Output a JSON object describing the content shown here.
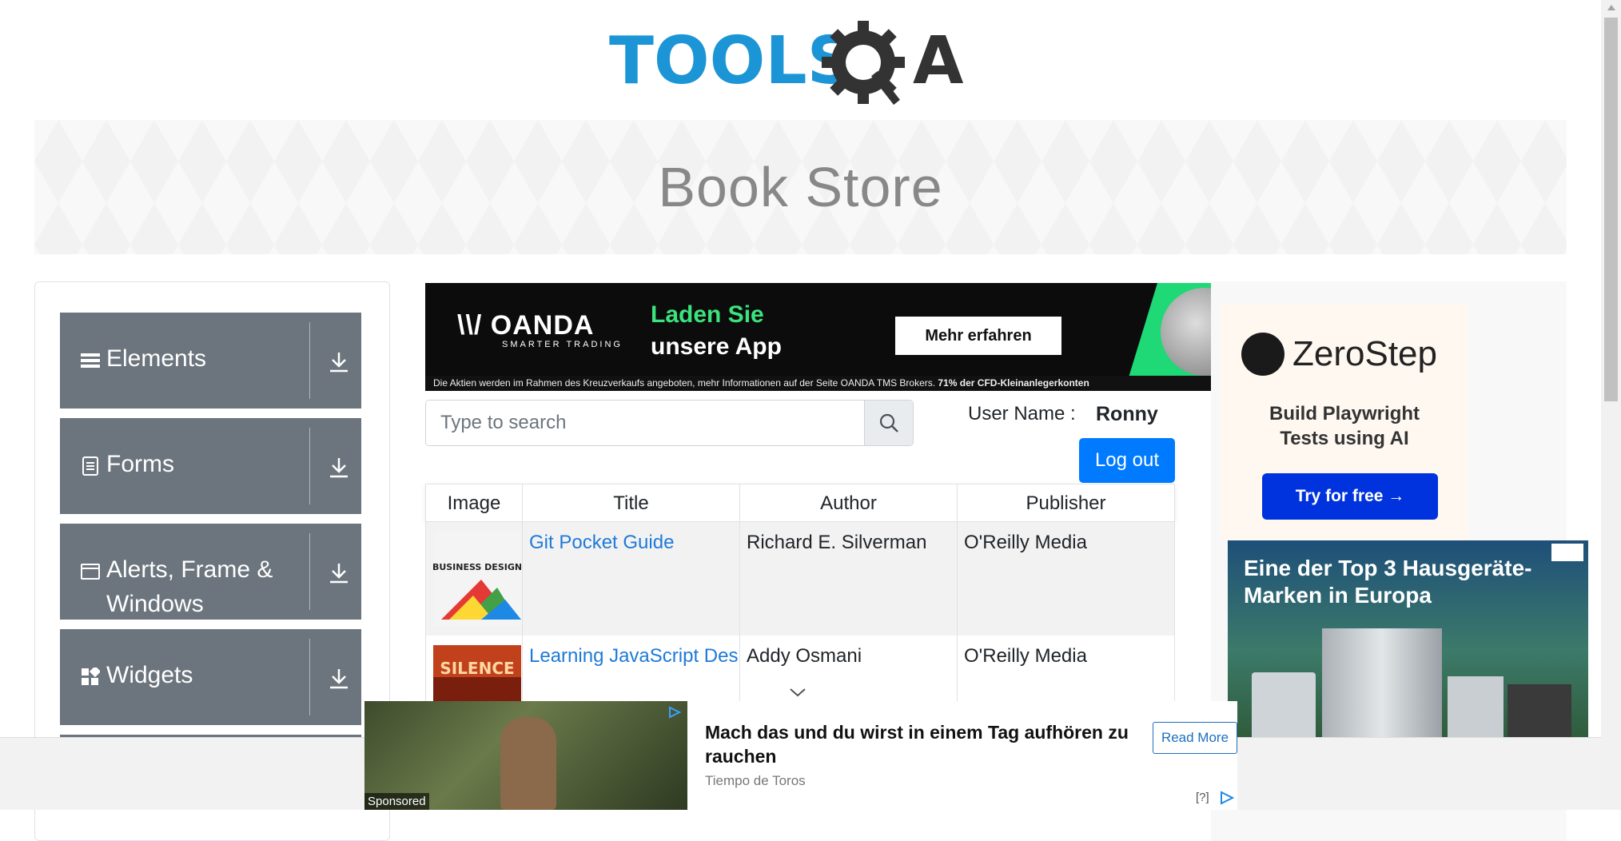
{
  "logo": {
    "text_left": "TOOLS",
    "text_right": "A",
    "colors": {
      "tools": "#1b95d5",
      "gear": "#333333"
    }
  },
  "banner": {
    "title": "Book Store"
  },
  "sidebar": {
    "groups": [
      {
        "label": "Elements",
        "icon": "hamburger-icon"
      },
      {
        "label": "Forms",
        "icon": "document-icon"
      },
      {
        "label": "Alerts, Frame & Windows",
        "icon": "window-icon"
      },
      {
        "label": "Widgets",
        "icon": "widgets-icon"
      }
    ]
  },
  "top_ad": {
    "brand": "OANDA",
    "brand_sub": "SMARTER TRADING",
    "headline_1": "Laden Sie",
    "headline_2": "unsere App",
    "cta": "Mehr erfahren",
    "disclaimer_1": "Die Aktien werden im Rahmen des Kreuzverkaufs angeboten, mehr Informationen auf der Seite OANDA TMS Brokers. ",
    "disclaimer_2": "71% der CFD-Kleinanlegerkonten"
  },
  "search": {
    "placeholder": "Type to search"
  },
  "user": {
    "label": "User Name :",
    "value": "Ronny",
    "logout": "Log out"
  },
  "table": {
    "headers": [
      "Image",
      "Title",
      "Author",
      "Publisher"
    ],
    "rows": [
      {
        "title": "Git Pocket Guide",
        "author": "Richard E. Silverman",
        "publisher": "O'Reilly Media",
        "cover_text": "BUSINESS DESIGN"
      },
      {
        "title": "Learning JavaScript Design Patterns",
        "author": "Addy Osmani",
        "publisher": "O'Reilly Media",
        "cover_text": "SILENCE"
      }
    ]
  },
  "right_ad_1": {
    "brand": "ZeroStep",
    "tagline_1": "Build Playwright",
    "tagline_2": "Tests using AI",
    "cta": "Try for free →"
  },
  "right_ad_2": {
    "headline_1": "Eine der Top 3 Hausgeräte-",
    "headline_2": "Marken in Europa"
  },
  "bottom_ad": {
    "label": "Sponsored",
    "headline": "Mach das und du wirst in einem Tag aufhören zu rauchen",
    "source": "Tiempo de Toros",
    "cta": "Read More",
    "help": "[?]"
  }
}
